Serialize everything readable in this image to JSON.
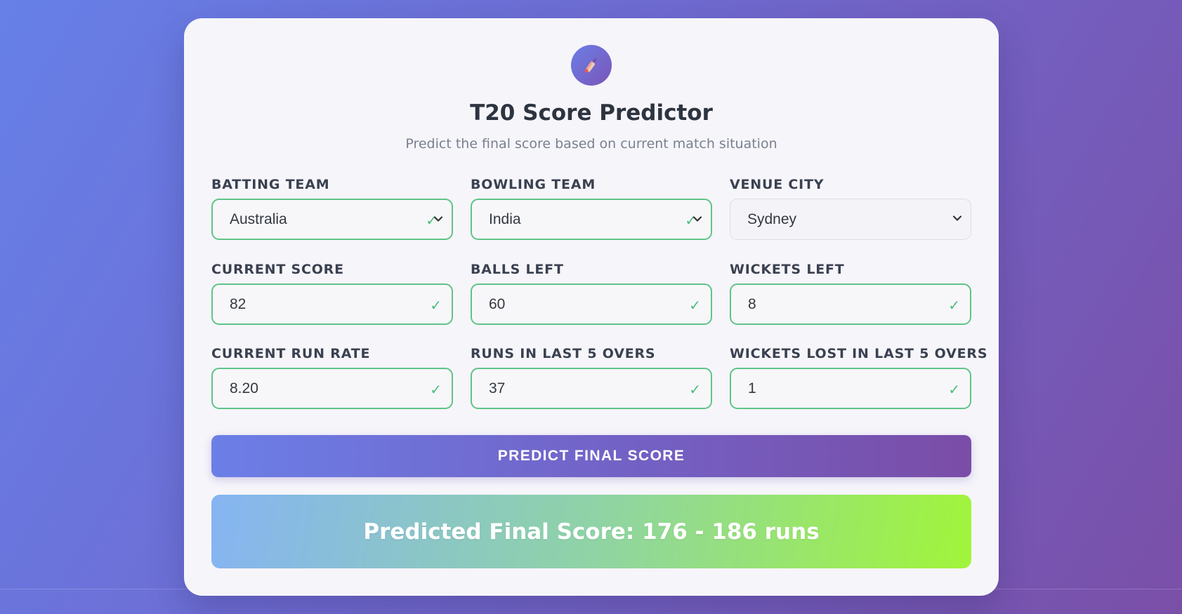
{
  "header": {
    "logo_icon": "cricket-bat-icon",
    "title": "T20 Score Predictor",
    "subtitle": "Predict the final score based on current match situation"
  },
  "form": {
    "batting_team": {
      "label": "BATTING TEAM",
      "value": "Australia"
    },
    "bowling_team": {
      "label": "BOWLING TEAM",
      "value": "India"
    },
    "venue_city": {
      "label": "VENUE CITY",
      "value": "Sydney"
    },
    "current_score": {
      "label": "CURRENT SCORE",
      "value": "82"
    },
    "balls_left": {
      "label": "BALLS LEFT",
      "value": "60"
    },
    "wickets_left": {
      "label": "WICKETS LEFT",
      "value": "8"
    },
    "current_run_rate": {
      "label": "CURRENT RUN RATE",
      "value": "8.20"
    },
    "runs_last_5": {
      "label": "RUNS IN LAST 5 OVERS",
      "value": "37"
    },
    "wickets_last_5": {
      "label": "WICKETS LOST IN LAST 5 OVERS",
      "value": "1"
    }
  },
  "predict_button": {
    "label": "PREDICT FINAL SCORE"
  },
  "result": {
    "text": "Predicted Final Score: 176 - 186 runs"
  },
  "colors": {
    "valid_border": "#5fc487",
    "button_start": "#6b7fe7",
    "button_end": "#7a4da7",
    "result_start": "#86b4f3",
    "result_end": "#a1f53a"
  }
}
